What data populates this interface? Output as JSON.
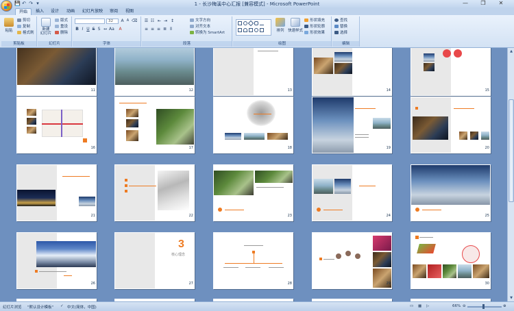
{
  "window": {
    "title": "1 - 长沙梅溪中心汇报 [兼容模式] - Microsoft PowerPoint",
    "controls": {
      "minimize": "—",
      "restore": "❐",
      "close": "✕"
    }
  },
  "qat": {
    "save": "💾",
    "undo": "↶",
    "redo": "↷",
    "more": "▾"
  },
  "tabs": [
    "开始",
    "插入",
    "设计",
    "动画",
    "幻灯片放映",
    "审阅",
    "视图"
  ],
  "ribbon": {
    "clipboard": {
      "label": "剪贴板",
      "paste": "粘贴",
      "cut": "剪切",
      "copy": "复制",
      "format_painter": "格式刷"
    },
    "slides": {
      "label": "幻灯片",
      "new_slide": "新建\n幻灯片",
      "layout": "版式",
      "reset": "重设",
      "delete": "删除"
    },
    "font": {
      "label": "字体",
      "font_name": "",
      "font_size": "32"
    },
    "paragraph": {
      "label": "段落",
      "text_direction": "文字方向",
      "align_text": "对齐文本",
      "smartart": "转换为 SmartArt"
    },
    "drawing": {
      "label": "绘图",
      "arrange": "排列",
      "quick_styles": "快速样式",
      "shape_fill": "形状填充",
      "shape_outline": "形状轮廓",
      "shape_effects": "形状效果"
    },
    "editing": {
      "label": "编辑",
      "find": "查找",
      "replace": "替换",
      "select": "选择"
    }
  },
  "slides": [
    {
      "num": "11"
    },
    {
      "num": "12"
    },
    {
      "num": "13"
    },
    {
      "num": "14"
    },
    {
      "num": "15"
    },
    {
      "num": "16"
    },
    {
      "num": "17"
    },
    {
      "num": "18"
    },
    {
      "num": "19"
    },
    {
      "num": "20"
    },
    {
      "num": "21"
    },
    {
      "num": "22"
    },
    {
      "num": "23"
    },
    {
      "num": "24"
    },
    {
      "num": "25"
    },
    {
      "num": "26"
    },
    {
      "num": "27"
    },
    {
      "num": "28"
    },
    {
      "num": "29"
    },
    {
      "num": "30"
    }
  ],
  "slide27": {
    "number_big": "3",
    "caption": "核心理念"
  },
  "status": {
    "view": "幻灯片浏览",
    "theme": "\"默认设计模板\"",
    "language": "中文(简体，中国)",
    "zoom": "66%",
    "zoom_minus": "⊖",
    "zoom_plus": "⊕"
  },
  "colors": {
    "accent": "#ee7b22",
    "sorter_bg": "#6e90bf",
    "ribbon_bg": "#dbe7f6"
  }
}
